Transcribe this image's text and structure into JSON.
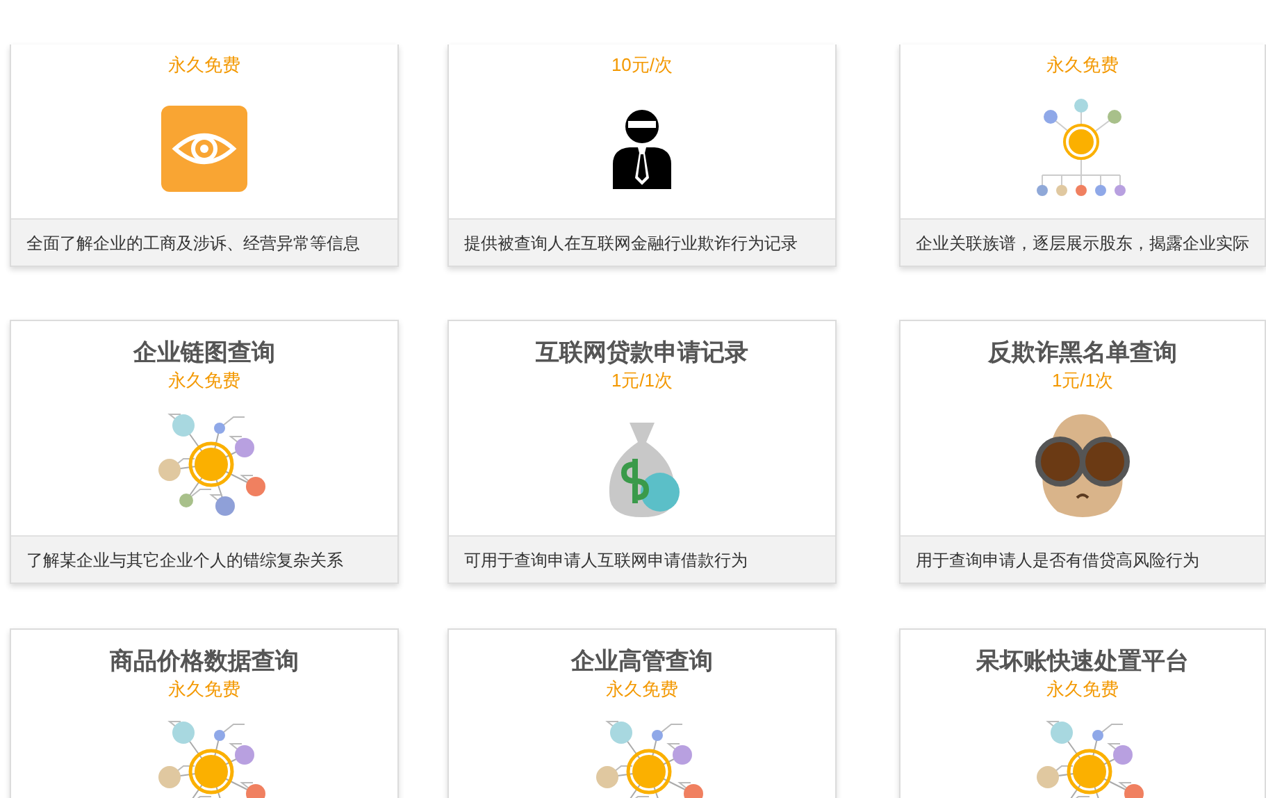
{
  "cards": [
    {
      "price": "永久免费",
      "kind": "eye",
      "description": "全面了解企业的工商及涉诉、经营异常等信息"
    },
    {
      "price": "10元/次",
      "kind": "person",
      "description": "提供被查询人在互联网金融行业欺诈行为记录"
    },
    {
      "price": "永久免费",
      "kind": "tree",
      "description": "企业关联族谱，逐层展示股东，揭露企业实际"
    },
    {
      "title": "企业链图查询",
      "price": "永久免费",
      "kind": "network",
      "description": "了解某企业与其它企业个人的错综复杂关系"
    },
    {
      "title": "互联网贷款申请记录",
      "price": "1元/1次",
      "kind": "moneybag",
      "description": "可用于查询申请人互联网申请借款行为"
    },
    {
      "title": "反欺诈黑名单查询",
      "price": "1元/1次",
      "kind": "face",
      "description": "用于查询申请人是否有借贷高风险行为"
    },
    {
      "title": "商品价格数据查询",
      "price": "永久免费",
      "kind": "network"
    },
    {
      "title": "企业高管查询",
      "price": "永久免费",
      "kind": "network"
    },
    {
      "title": "呆坏账快速处置平台",
      "price": "永久免费",
      "kind": "network"
    }
  ]
}
